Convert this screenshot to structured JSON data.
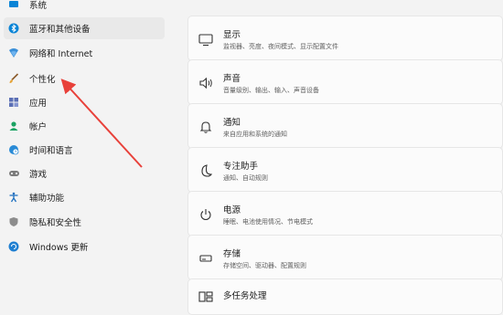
{
  "sidebar": {
    "items": [
      {
        "label": "系统",
        "icon": "system-icon"
      },
      {
        "label": "蓝牙和其他设备",
        "icon": "bluetooth-icon",
        "selected": true
      },
      {
        "label": "网络和 Internet",
        "icon": "network-icon"
      },
      {
        "label": "个性化",
        "icon": "brush-icon"
      },
      {
        "label": "应用",
        "icon": "apps-icon"
      },
      {
        "label": "帐户",
        "icon": "account-icon"
      },
      {
        "label": "时间和语言",
        "icon": "globe-clock-icon"
      },
      {
        "label": "游戏",
        "icon": "gamepad-icon"
      },
      {
        "label": "辅助功能",
        "icon": "accessibility-icon"
      },
      {
        "label": "隐私和安全性",
        "icon": "shield-icon"
      },
      {
        "label": "Windows 更新",
        "icon": "windows-update-icon"
      }
    ]
  },
  "cards": [
    {
      "title": "显示",
      "subtitle": "监视器、亮度、夜间模式、显示配置文件",
      "icon": "monitor-icon"
    },
    {
      "title": "声音",
      "subtitle": "音量级别、输出、输入、声音设备",
      "icon": "speaker-icon"
    },
    {
      "title": "通知",
      "subtitle": "来自应用和系统的通知",
      "icon": "bell-icon"
    },
    {
      "title": "专注助手",
      "subtitle": "通知、自动规则",
      "icon": "moon-icon"
    },
    {
      "title": "电源",
      "subtitle": "睡眠、电池使用情况、节电模式",
      "icon": "power-icon"
    },
    {
      "title": "存储",
      "subtitle": "存储空间、驱动器、配置规则",
      "icon": "storage-icon"
    },
    {
      "title": "多任务处理",
      "subtitle": "",
      "icon": "multitask-icon"
    }
  ],
  "colors": {
    "accent": "#0067c0",
    "annotation_arrow": "#e8413a"
  }
}
